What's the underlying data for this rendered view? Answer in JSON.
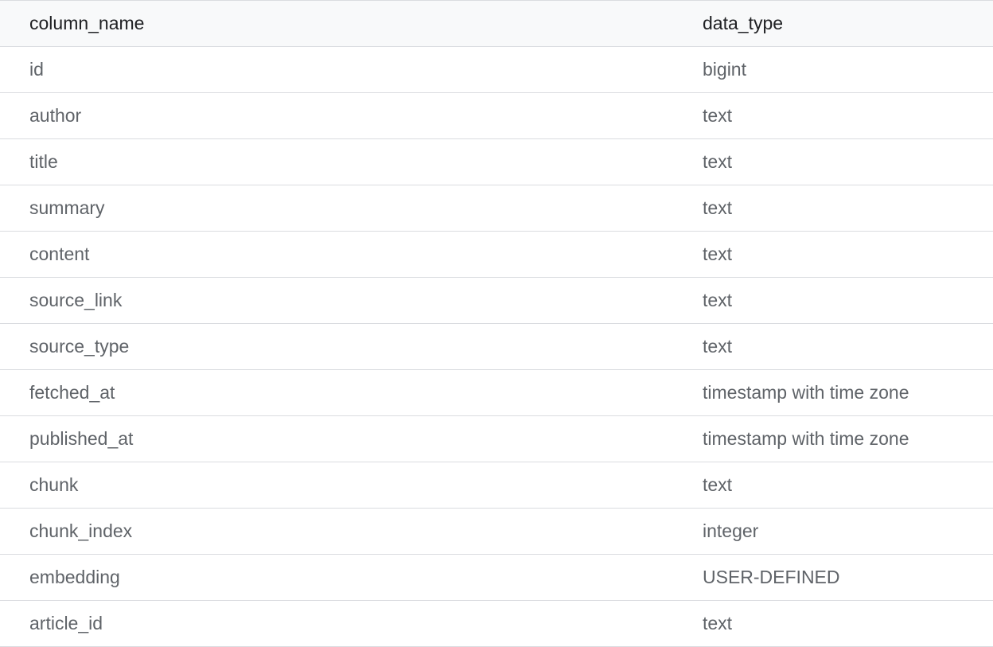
{
  "table": {
    "headers": {
      "column_name": "column_name",
      "data_type": "data_type"
    },
    "rows": [
      {
        "column_name": "id",
        "data_type": "bigint"
      },
      {
        "column_name": "author",
        "data_type": "text"
      },
      {
        "column_name": "title",
        "data_type": "text"
      },
      {
        "column_name": "summary",
        "data_type": "text"
      },
      {
        "column_name": "content",
        "data_type": "text"
      },
      {
        "column_name": "source_link",
        "data_type": "text"
      },
      {
        "column_name": "source_type",
        "data_type": "text"
      },
      {
        "column_name": "fetched_at",
        "data_type": "timestamp with time zone"
      },
      {
        "column_name": "published_at",
        "data_type": "timestamp with time zone"
      },
      {
        "column_name": "chunk",
        "data_type": "text"
      },
      {
        "column_name": "chunk_index",
        "data_type": "integer"
      },
      {
        "column_name": "embedding",
        "data_type": "USER-DEFINED"
      },
      {
        "column_name": "article_id",
        "data_type": "text"
      }
    ]
  }
}
